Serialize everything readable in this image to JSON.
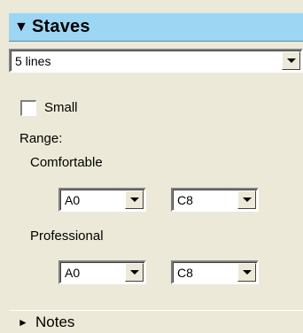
{
  "staves_section": {
    "arrow_glyph": "▼",
    "title": "Staves",
    "lines_value": "5 lines",
    "small_label": "Small",
    "small_checked": false,
    "range_label": "Range:",
    "comfortable_label": "Comfortable",
    "comfortable_low": "A0",
    "comfortable_high": "C8",
    "professional_label": "Professional",
    "professional_low": "A0",
    "professional_high": "C8"
  },
  "notes_section": {
    "arrow_glyph": "►",
    "title": "Notes"
  }
}
